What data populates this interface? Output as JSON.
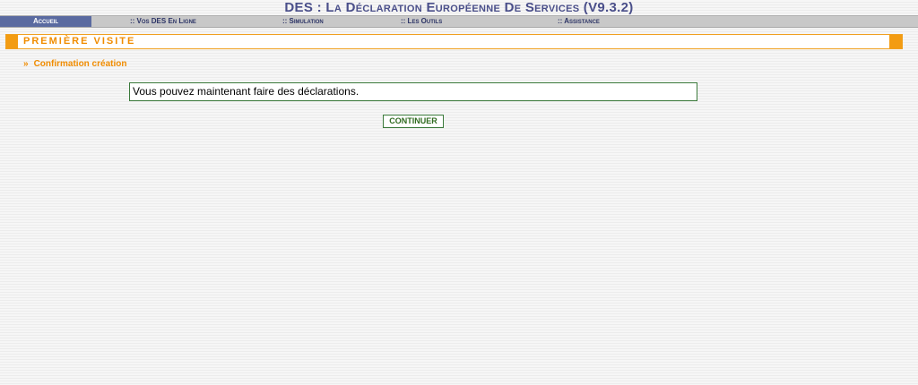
{
  "header": {
    "title": "DES : La Déclaration Européenne De Services (V9.3.2)"
  },
  "nav": {
    "items": [
      {
        "label": "Accueil"
      },
      {
        "label": ":: Vos DES En Ligne"
      },
      {
        "label": ":: Simulation"
      },
      {
        "label": ":: Les Outils"
      },
      {
        "label": ":: Assistance"
      }
    ]
  },
  "section": {
    "title": "PREMIÈRE VISITE",
    "subtitle_arrow": "»",
    "subtitle": "Confirmation création"
  },
  "message": {
    "text": "Vous pouvez maintenant faire des déclarations."
  },
  "actions": {
    "continue_label": "CONTINUER"
  },
  "colors": {
    "title": "#4a4f8a",
    "nav_active": "#5a6aa0",
    "accent_orange": "#f39c12",
    "box_border_green": "#3b7a3b"
  }
}
